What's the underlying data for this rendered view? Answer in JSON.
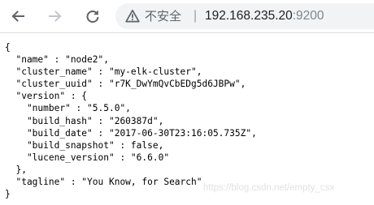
{
  "browser": {
    "security_label": "不安全",
    "separator": "|",
    "url_host": "192.168.235.20",
    "url_port": ":9200",
    "icons": {
      "back": "arrow-left-icon",
      "forward": "arrow-right-icon",
      "reload": "reload-icon",
      "security": "warning-triangle-icon"
    }
  },
  "response": {
    "lines": [
      "{",
      "  \"name\" : \"node2\",",
      "  \"cluster_name\" : \"my-elk-cluster\",",
      "  \"cluster_uuid\" : \"r7K_DwYmQvCbEDg5d6JBPw\",",
      "  \"version\" : {",
      "    \"number\" : \"5.5.0\",",
      "    \"build_hash\" : \"260387d\",",
      "    \"build_date\" : \"2017-06-30T23:16:05.735Z\",",
      "    \"build_snapshot\" : false,",
      "    \"lucene_version\" : \"6.6.0\"",
      "  },",
      "  \"tagline\" : \"You Know, for Search\"",
      "}"
    ]
  },
  "watermark": "https://blog.csdn.net/empty_csx"
}
